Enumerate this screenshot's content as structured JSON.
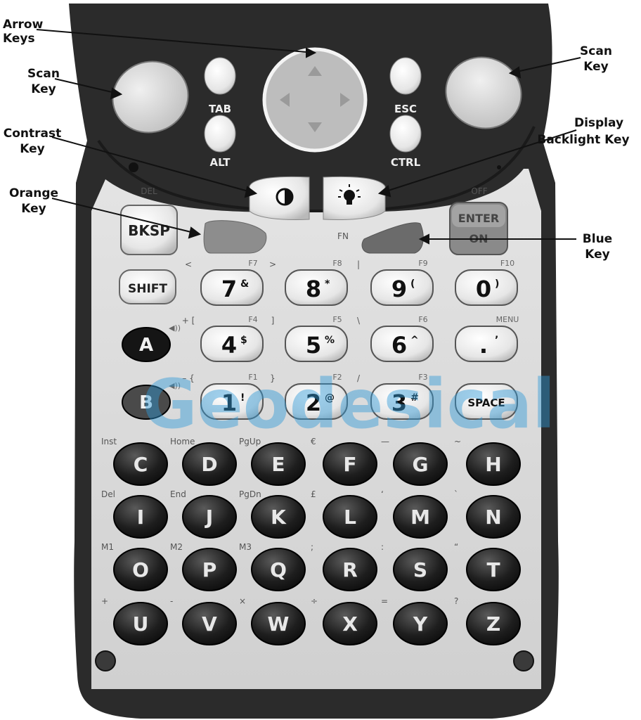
{
  "callouts": {
    "arrow_keys": [
      "Arrow",
      "Keys"
    ],
    "scan_key_left": [
      "Scan",
      "Key"
    ],
    "scan_key_right": [
      "Scan",
      "Key"
    ],
    "contrast_key": [
      "Contrast",
      "Key"
    ],
    "display_backlight_key": [
      "Display",
      "Backlight Key"
    ],
    "orange_key": [
      "Orange",
      "Key"
    ],
    "blue_key": [
      "Blue",
      "Key"
    ]
  },
  "top_keys": {
    "tab": "TAB",
    "alt": "ALT",
    "esc": "ESC",
    "ctrl": "CTRL"
  },
  "function_row": {
    "del": "DEL",
    "bksp": "BKSP",
    "fn": "FN",
    "off": "OFF",
    "enter": "ENTER",
    "on": "ON"
  },
  "numeric_rows": [
    {
      "left": "SHIFT",
      "keys": [
        {
          "main": "7",
          "sup": "&",
          "fn": "F7",
          "alt": "<"
        },
        {
          "main": "8",
          "sup": "*",
          "fn": "F8",
          "alt": ">"
        },
        {
          "main": "9",
          "sup": "(",
          "fn": "F9",
          "alt": "|"
        },
        {
          "main": "0",
          "sup": ")",
          "fn": "F10",
          "alt": ""
        }
      ]
    },
    {
      "left": "A",
      "keys": [
        {
          "main": "4",
          "sup": "$",
          "fn": "F4",
          "alt": "+ ["
        },
        {
          "main": "5",
          "sup": "%",
          "fn": "F5",
          "alt": "]"
        },
        {
          "main": "6",
          "sup": "^",
          "fn": "F6",
          "alt": "\\"
        },
        {
          "main": ".",
          "sup": "’",
          "fn": "MENU",
          "alt": ""
        }
      ]
    },
    {
      "left": "B",
      "keys": [
        {
          "main": "1",
          "sup": "!",
          "fn": "F1",
          "alt": "– {"
        },
        {
          "main": "2",
          "sup": "@",
          "fn": "F2",
          "alt": "}"
        },
        {
          "main": "3",
          "sup": "#",
          "fn": "F3",
          "alt": "/"
        },
        {
          "main": "SPACE",
          "sup": "",
          "fn": "",
          "alt": ""
        }
      ]
    }
  ],
  "letter_rows": [
    {
      "keys": [
        "C",
        "D",
        "E",
        "F",
        "G",
        "H"
      ],
      "labels": [
        "Inst",
        "Home",
        "PgUp",
        "€",
        "—",
        "~"
      ]
    },
    {
      "keys": [
        "I",
        "J",
        "K",
        "L",
        "M",
        "N"
      ],
      "labels": [
        "Del",
        "End",
        "PgDn",
        "£",
        "‘",
        "`"
      ]
    },
    {
      "keys": [
        "O",
        "P",
        "Q",
        "R",
        "S",
        "T"
      ],
      "labels": [
        "M1",
        "M2",
        "M3",
        ";",
        ":",
        "“"
      ]
    },
    {
      "keys": [
        "U",
        "V",
        "W",
        "X",
        "Y",
        "Z"
      ],
      "labels": [
        "+",
        "-",
        "×",
        "÷",
        "=",
        "?"
      ]
    }
  ],
  "watermark": "Geodesical",
  "colors": {
    "body_dark": "#2a2a2a",
    "keypad_panel": "#d9d9d9",
    "orange_key": "#8a8a8a",
    "blue_key": "#6d6d6d",
    "watermark": "#2f9ad6"
  }
}
